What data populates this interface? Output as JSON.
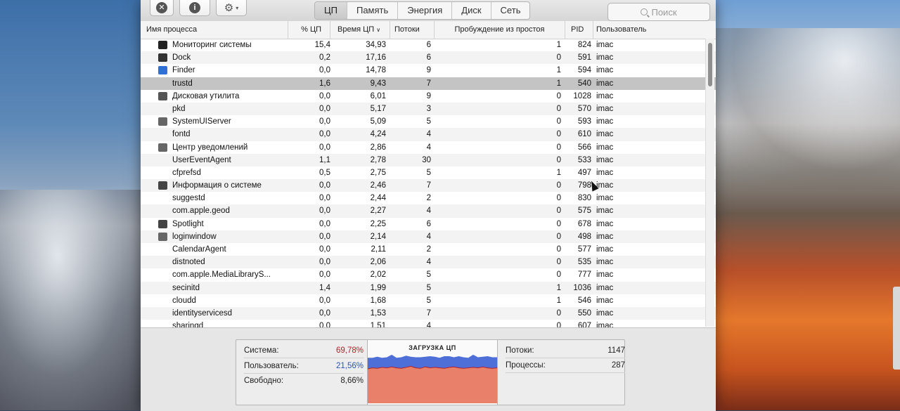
{
  "toolbar": {
    "close_icon": "x-circle-icon",
    "info_icon": "info-icon",
    "gear_icon": "gear-icon",
    "tabs": [
      "ЦП",
      "Память",
      "Энергия",
      "Диск",
      "Сеть"
    ],
    "active_tab": "ЦП",
    "search_placeholder": "Поиск"
  },
  "columns": {
    "name": "Имя процесса",
    "cpu": "% ЦП",
    "time": "Время ЦП",
    "threads": "Потоки",
    "wake": "Пробуждение из простоя",
    "pid": "PID",
    "user": "Пользователь"
  },
  "processes": [
    {
      "name": "Мониторинг системы",
      "cpu": "15,4",
      "time": "34,93",
      "threads": "6",
      "wake": "1",
      "pid": "824",
      "user": "imac",
      "icon": "activity-monitor-icon",
      "icon_color": "#222222"
    },
    {
      "name": "Dock",
      "cpu": "0,2",
      "time": "17,16",
      "threads": "6",
      "wake": "0",
      "pid": "591",
      "user": "imac",
      "icon": "dock-icon",
      "icon_color": "#333333"
    },
    {
      "name": "Finder",
      "cpu": "0,0",
      "time": "14,78",
      "threads": "9",
      "wake": "1",
      "pid": "594",
      "user": "imac",
      "icon": "finder-icon",
      "icon_color": "#2f6fd6"
    },
    {
      "name": "trustd",
      "cpu": "1,6",
      "time": "9,43",
      "threads": "7",
      "wake": "1",
      "pid": "540",
      "user": "imac",
      "icon": "",
      "icon_color": ""
    },
    {
      "name": "Дисковая утилита",
      "cpu": "0,0",
      "time": "6,01",
      "threads": "9",
      "wake": "0",
      "pid": "1028",
      "user": "imac",
      "icon": "disk-utility-icon",
      "icon_color": "#555555"
    },
    {
      "name": "pkd",
      "cpu": "0,0",
      "time": "5,17",
      "threads": "3",
      "wake": "0",
      "pid": "570",
      "user": "imac",
      "icon": "",
      "icon_color": ""
    },
    {
      "name": "SystemUIServer",
      "cpu": "0,0",
      "time": "5,09",
      "threads": "5",
      "wake": "0",
      "pid": "593",
      "user": "imac",
      "icon": "system-ui-icon",
      "icon_color": "#666666"
    },
    {
      "name": "fontd",
      "cpu": "0,0",
      "time": "4,24",
      "threads": "4",
      "wake": "0",
      "pid": "610",
      "user": "imac",
      "icon": "",
      "icon_color": ""
    },
    {
      "name": "Центр уведомлений",
      "cpu": "0,0",
      "time": "2,86",
      "threads": "4",
      "wake": "0",
      "pid": "566",
      "user": "imac",
      "icon": "notification-center-icon",
      "icon_color": "#666666"
    },
    {
      "name": "UserEventAgent",
      "cpu": "1,1",
      "time": "2,78",
      "threads": "30",
      "wake": "0",
      "pid": "533",
      "user": "imac",
      "icon": "",
      "icon_color": ""
    },
    {
      "name": "cfprefsd",
      "cpu": "0,5",
      "time": "2,75",
      "threads": "5",
      "wake": "1",
      "pid": "497",
      "user": "imac",
      "icon": "",
      "icon_color": ""
    },
    {
      "name": "Информация о системе",
      "cpu": "0,0",
      "time": "2,46",
      "threads": "7",
      "wake": "0",
      "pid": "798",
      "user": "imac",
      "icon": "system-info-icon",
      "icon_color": "#444444"
    },
    {
      "name": "suggestd",
      "cpu": "0,0",
      "time": "2,44",
      "threads": "2",
      "wake": "0",
      "pid": "830",
      "user": "imac",
      "icon": "",
      "icon_color": ""
    },
    {
      "name": "com.apple.geod",
      "cpu": "0,0",
      "time": "2,27",
      "threads": "4",
      "wake": "0",
      "pid": "575",
      "user": "imac",
      "icon": "",
      "icon_color": ""
    },
    {
      "name": "Spotlight",
      "cpu": "0,0",
      "time": "2,25",
      "threads": "6",
      "wake": "0",
      "pid": "678",
      "user": "imac",
      "icon": "spotlight-icon",
      "icon_color": "#444444"
    },
    {
      "name": "loginwindow",
      "cpu": "0,0",
      "time": "2,14",
      "threads": "4",
      "wake": "0",
      "pid": "498",
      "user": "imac",
      "icon": "loginwindow-icon",
      "icon_color": "#666666"
    },
    {
      "name": "CalendarAgent",
      "cpu": "0,0",
      "time": "2,11",
      "threads": "2",
      "wake": "0",
      "pid": "577",
      "user": "imac",
      "icon": "",
      "icon_color": ""
    },
    {
      "name": "distnoted",
      "cpu": "0,0",
      "time": "2,06",
      "threads": "4",
      "wake": "0",
      "pid": "535",
      "user": "imac",
      "icon": "",
      "icon_color": ""
    },
    {
      "name": "com.apple.MediaLibraryS...",
      "cpu": "0,0",
      "time": "2,02",
      "threads": "5",
      "wake": "0",
      "pid": "777",
      "user": "imac",
      "icon": "",
      "icon_color": ""
    },
    {
      "name": "secinitd",
      "cpu": "1,4",
      "time": "1,99",
      "threads": "5",
      "wake": "1",
      "pid": "1036",
      "user": "imac",
      "icon": "",
      "icon_color": ""
    },
    {
      "name": "cloudd",
      "cpu": "0,0",
      "time": "1,68",
      "threads": "5",
      "wake": "1",
      "pid": "546",
      "user": "imac",
      "icon": "",
      "icon_color": ""
    },
    {
      "name": "identityservicesd",
      "cpu": "0,0",
      "time": "1,53",
      "threads": "7",
      "wake": "0",
      "pid": "550",
      "user": "imac",
      "icon": "",
      "icon_color": ""
    },
    {
      "name": "sharingd",
      "cpu": "0,0",
      "time": "1,51",
      "threads": "4",
      "wake": "0",
      "pid": "607",
      "user": "imac",
      "icon": "",
      "icon_color": ""
    }
  ],
  "selected_row": 3,
  "stats": {
    "system_label": "Система:",
    "system_value": "69,78%",
    "system_color": "#b0222a",
    "user_label": "Пользователь:",
    "user_value": "21,56%",
    "user_color": "#2a55b0",
    "idle_label": "Свободно:",
    "idle_value": "8,66%",
    "graph_title": "ЗАГРУЗКА ЦП",
    "threads_label": "Потоки:",
    "threads_value": "1147",
    "processes_label": "Процессы:",
    "processes_value": "287"
  },
  "cpu_graph": {
    "system_color": "#e8806a",
    "user_color": "#4f6fd8",
    "system_pct": [
      68,
      70,
      69,
      71,
      70,
      72,
      70,
      69,
      71,
      73,
      70,
      69,
      72,
      70,
      71,
      70,
      69,
      71,
      72,
      70,
      69,
      70,
      71,
      70,
      72,
      70,
      69,
      70
    ],
    "user_pct": [
      22,
      20,
      23,
      19,
      21,
      24,
      20,
      22,
      23,
      19,
      21,
      22,
      20,
      23,
      21,
      20,
      24,
      22,
      19,
      23,
      22,
      20,
      25,
      21,
      20,
      23,
      22,
      21
    ]
  }
}
